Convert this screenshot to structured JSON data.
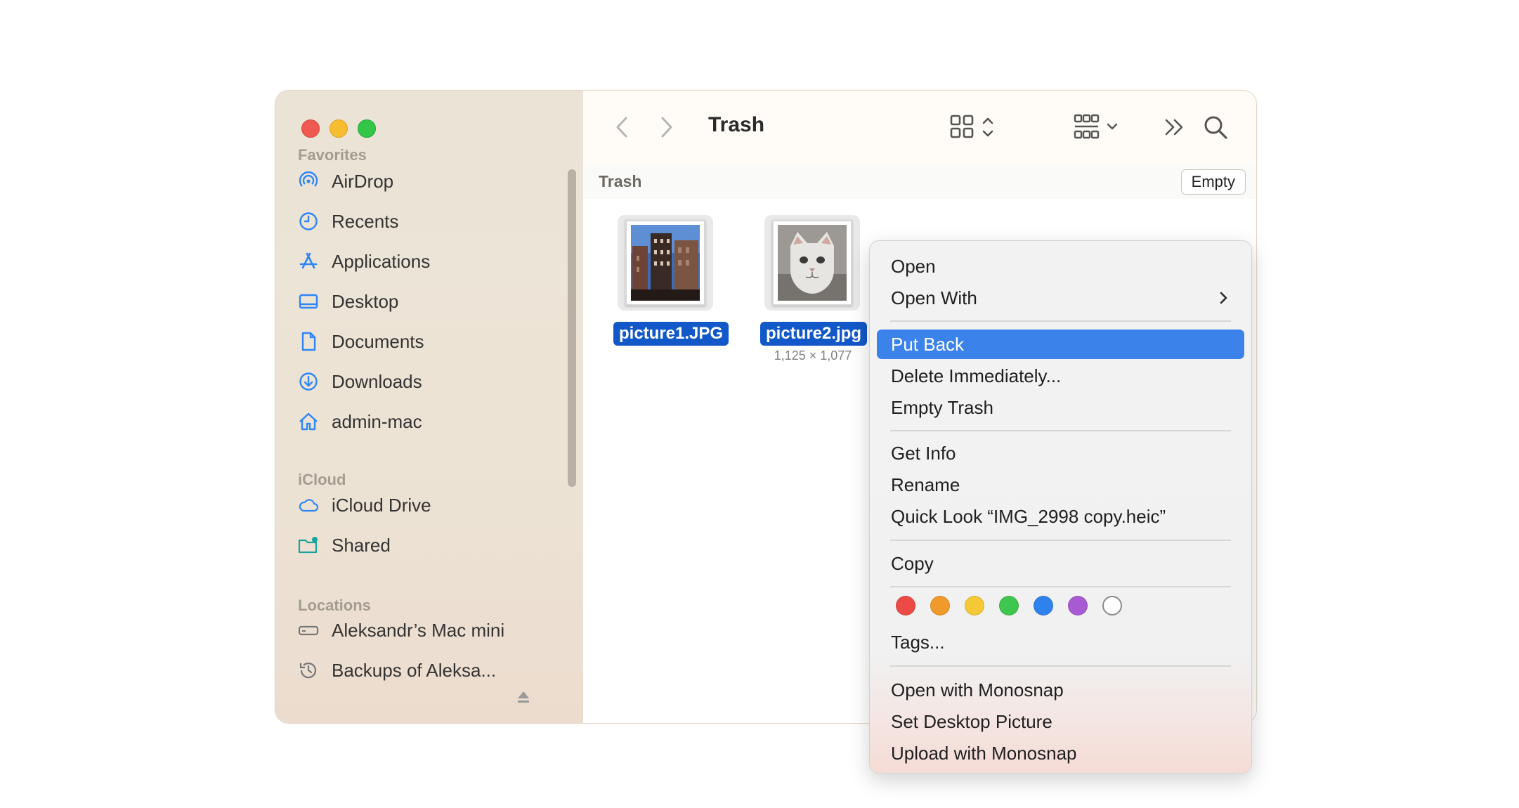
{
  "sidebar": {
    "favorites_label": "Favorites",
    "favorites": [
      {
        "label": "AirDrop",
        "icon": "airdrop-icon"
      },
      {
        "label": "Recents",
        "icon": "clock-icon"
      },
      {
        "label": "Applications",
        "icon": "applications-icon"
      },
      {
        "label": "Desktop",
        "icon": "desktop-icon"
      },
      {
        "label": "Documents",
        "icon": "document-icon"
      },
      {
        "label": "Downloads",
        "icon": "download-icon"
      },
      {
        "label": "admin-mac",
        "icon": "home-icon"
      }
    ],
    "icloud_label": "iCloud",
    "icloud": [
      {
        "label": "iCloud Drive",
        "icon": "cloud-icon"
      },
      {
        "label": "Shared",
        "icon": "shared-folder-icon"
      }
    ],
    "locations_label": "Locations",
    "locations": [
      {
        "label": "Aleksandr’s Mac mini",
        "icon": "computer-icon"
      },
      {
        "label": "Backups of Aleksa...",
        "icon": "time-machine-icon"
      }
    ]
  },
  "toolbar": {
    "title": "Trash"
  },
  "pathbar": {
    "label": "Trash",
    "empty_button": "Empty"
  },
  "files": [
    {
      "name": "picture1.JPG",
      "sub": ""
    },
    {
      "name": "picture2.jpg",
      "sub": "1,125 × 1,077"
    }
  ],
  "context_menu": {
    "open": "Open",
    "open_with": "Open With",
    "put_back": "Put Back",
    "delete_immediately": "Delete Immediately...",
    "empty_trash": "Empty Trash",
    "get_info": "Get Info",
    "rename": "Rename",
    "quick_look": "Quick Look “IMG_2998 copy.heic”",
    "copy": "Copy",
    "tags": "Tags...",
    "open_monosnap": "Open with Monosnap",
    "set_desktop": "Set Desktop Picture",
    "upload_monosnap": "Upload with Monosnap",
    "tag_colors": [
      "#ec4a45",
      "#f19a2c",
      "#f5c935",
      "#3ec64e",
      "#2f82ec",
      "#a85ad2",
      "#ffffff"
    ]
  }
}
